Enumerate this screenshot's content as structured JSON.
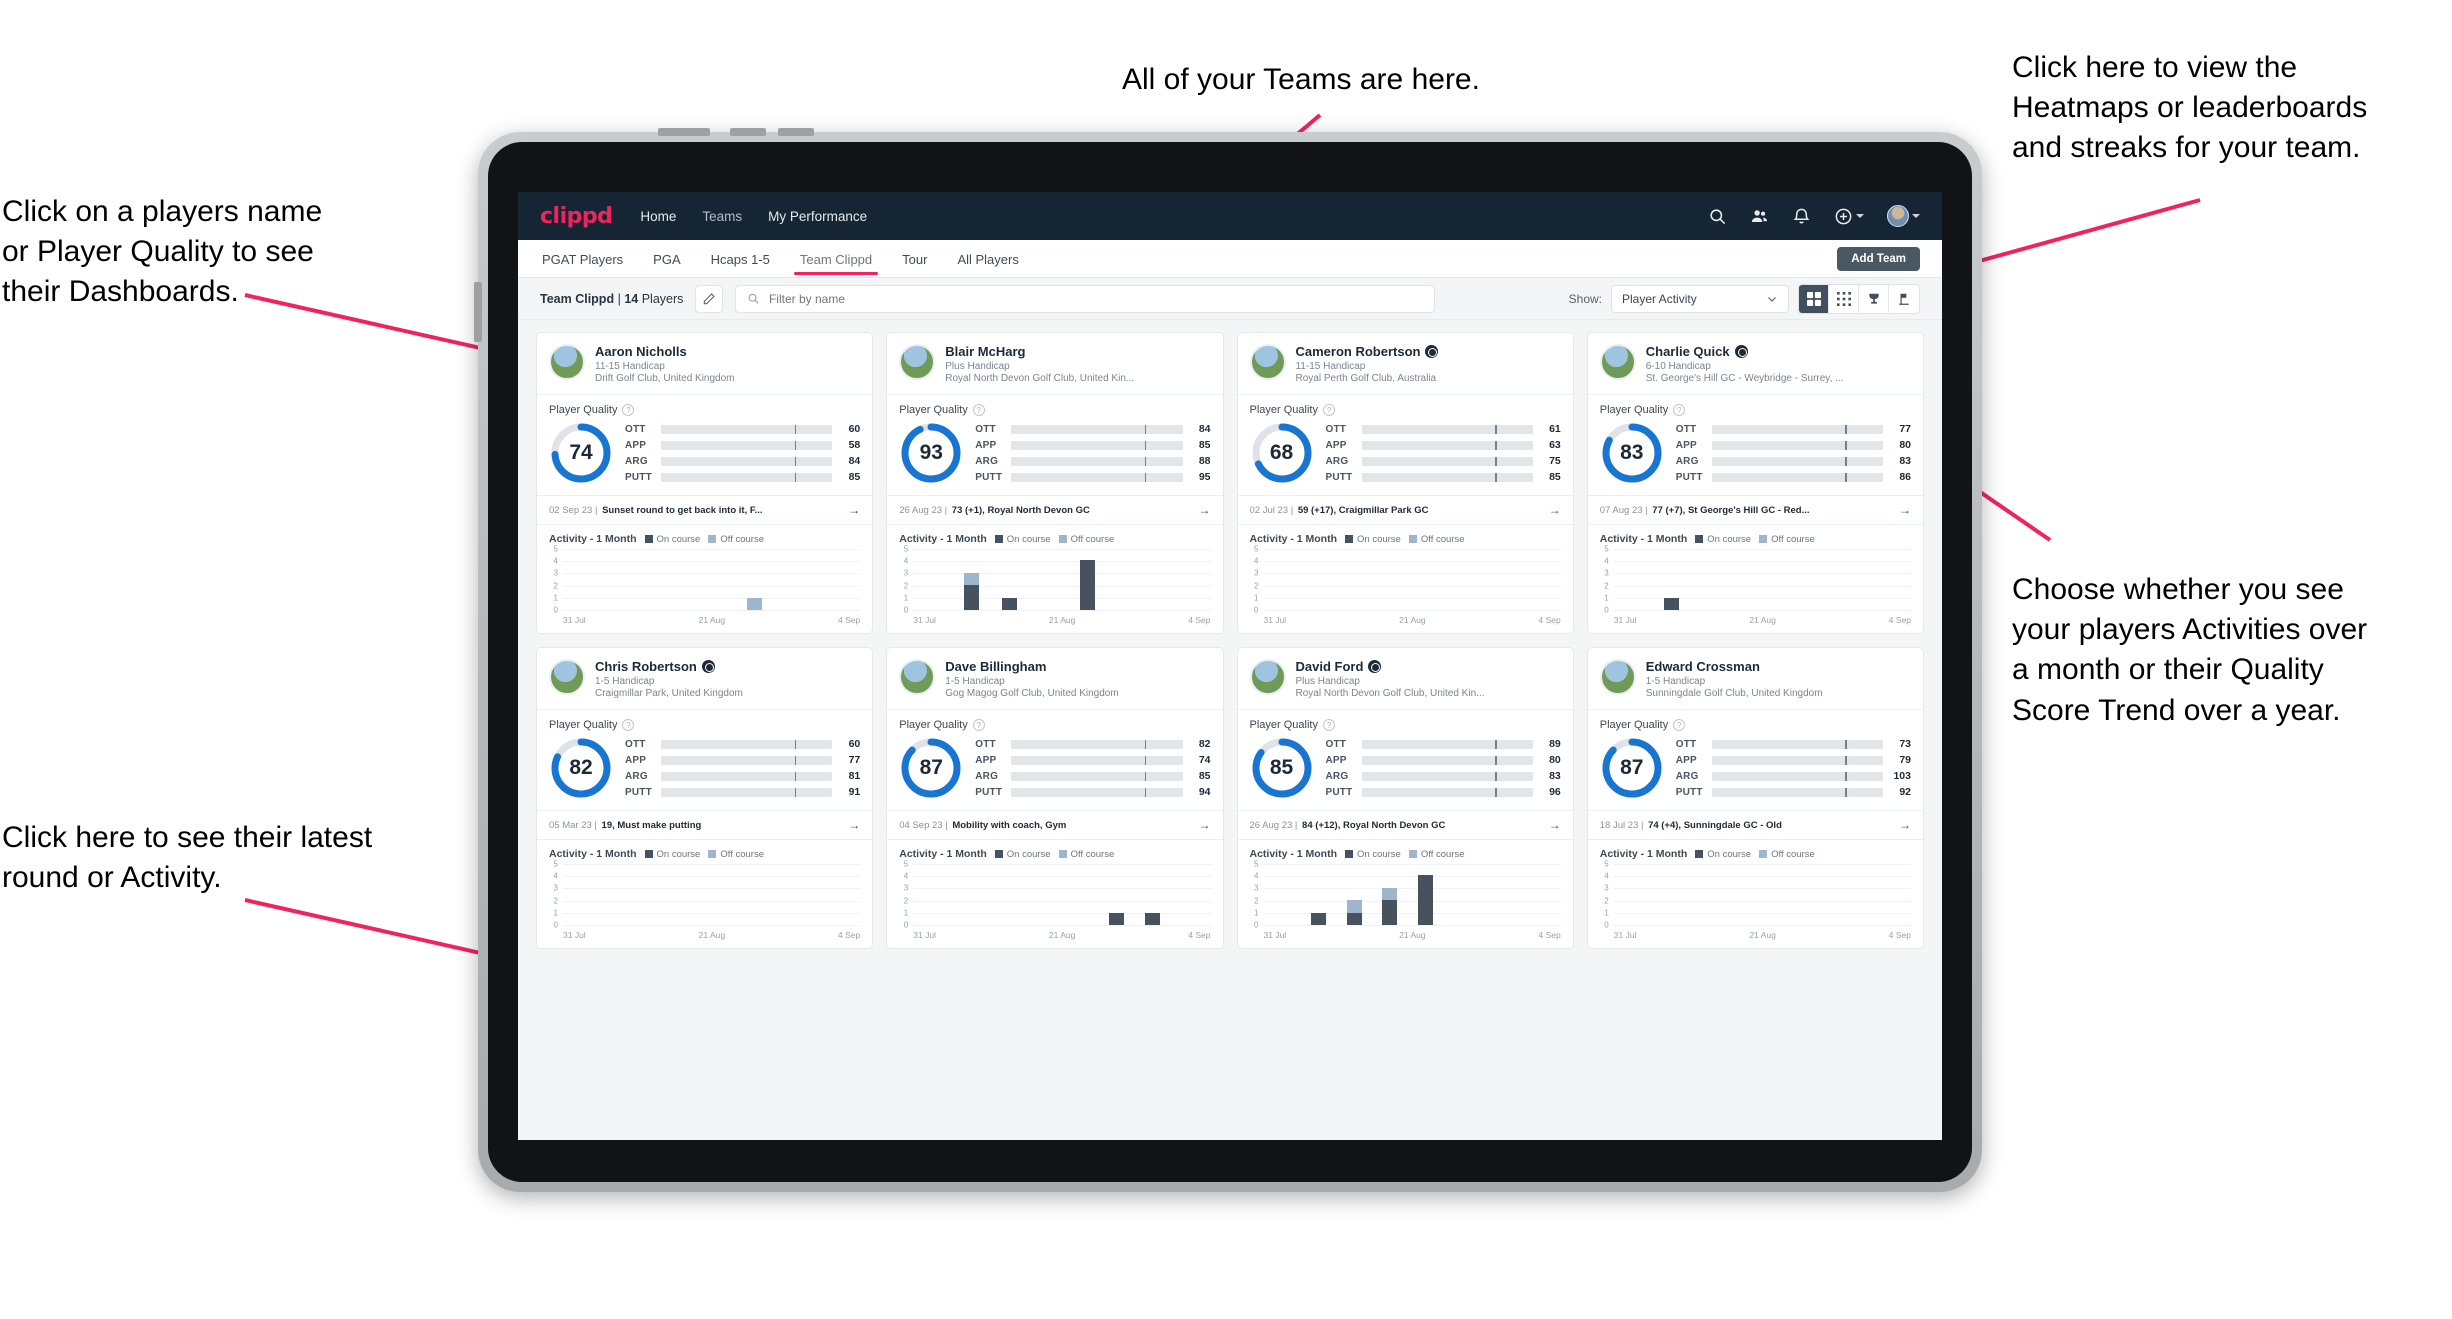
{
  "annotations": {
    "top": "All of your Teams are here.",
    "left_top": "Click on a players name\nor Player Quality to see\ntheir Dashboards.",
    "left_bottom": "Click here to see their latest\nround or Activity.",
    "right_top": "Click here to view the\nHeatmaps or leaderboards\nand streaks for your team.",
    "right_bottom": "Choose whether you see\nyour players Activities over\na month or their Quality\nScore Trend over a year."
  },
  "colors": {
    "brand_pink": "#f0245c",
    "nav_bg": "#152533",
    "ring_blue": "#1876d2",
    "ott": "#f5a623",
    "app": "#36d3ad",
    "arg": "#f5215e",
    "putt": "#a715d6",
    "on_course": "#46535f",
    "off_course": "#9db6cc"
  },
  "navbar": {
    "logo": "clippd",
    "links": [
      "Home",
      "Teams",
      "My Performance"
    ],
    "icons": [
      "search-icon",
      "people-icon",
      "bell-icon",
      "plus-circle-icon",
      "avatar"
    ]
  },
  "tabs": {
    "items": [
      "PGAT Players",
      "PGA",
      "Hcaps 1-5",
      "Team Clippd",
      "Tour",
      "All Players"
    ],
    "active": "Team Clippd",
    "add_team_label": "Add Team"
  },
  "filterbar": {
    "team_name": "Team Clippd",
    "separator": "|",
    "player_count": "14",
    "players_word": "Players",
    "search_placeholder": "Filter by name",
    "show_label": "Show:",
    "show_value": "Player Activity",
    "view_icons": [
      "grid-large-icon",
      "grid-dots-icon",
      "trophy-icon",
      "streaks-icon"
    ]
  },
  "card_common": {
    "player_quality_label": "Player Quality",
    "activity_label": "Activity - 1 Month",
    "legend_on": "On course",
    "legend_off": "Off course",
    "bar_labels": [
      "OTT",
      "APP",
      "ARG",
      "PUTT"
    ],
    "y_ticks": [
      "5",
      "4",
      "3",
      "2",
      "1",
      "0"
    ],
    "x_ticks": [
      "31 Jul",
      "21 Aug",
      "4 Sep"
    ]
  },
  "players": [
    {
      "name": "Aaron Nicholls",
      "verified": false,
      "handicap": "11-15 Handicap",
      "club": "Drift Golf Club, United Kingdom",
      "quality": 74,
      "metrics": [
        60,
        58,
        84,
        85
      ],
      "round_date": "02 Sep 23",
      "round_text": "Sunset round to get back into it, F...",
      "activity": [
        {
          "x": 62,
          "on": 0,
          "off": 1
        }
      ]
    },
    {
      "name": "Blair McHarg",
      "verified": false,
      "handicap": "Plus Handicap",
      "club": "Royal North Devon Golf Club, United Kin...",
      "quality": 93,
      "metrics": [
        84,
        85,
        88,
        95
      ],
      "round_date": "26 Aug 23",
      "round_text": "73 (+1), Royal North Devon GC",
      "activity": [
        {
          "x": 17,
          "on": 2,
          "off": 1
        },
        {
          "x": 30,
          "on": 1,
          "off": 0
        },
        {
          "x": 56,
          "on": 4,
          "off": 0
        }
      ]
    },
    {
      "name": "Cameron Robertson",
      "verified": true,
      "handicap": "11-15 Handicap",
      "club": "Royal Perth Golf Club, Australia",
      "quality": 68,
      "metrics": [
        61,
        63,
        75,
        85
      ],
      "round_date": "02 Jul 23",
      "round_text": "59 (+17), Craigmillar Park GC",
      "activity": []
    },
    {
      "name": "Charlie Quick",
      "verified": true,
      "handicap": "6-10 Handicap",
      "club": "St. George's Hill GC - Weybridge - Surrey, ...",
      "quality": 83,
      "metrics": [
        77,
        80,
        83,
        86
      ],
      "round_date": "07 Aug 23",
      "round_text": "77 (+7), St George's Hill GC - Red...",
      "activity": [
        {
          "x": 17,
          "on": 1,
          "off": 0
        }
      ]
    },
    {
      "name": "Chris Robertson",
      "verified": true,
      "handicap": "1-5 Handicap",
      "club": "Craigmillar Park, United Kingdom",
      "quality": 82,
      "metrics": [
        60,
        77,
        81,
        91
      ],
      "round_date": "05 Mar 23",
      "round_text": "19, Must make putting",
      "activity": []
    },
    {
      "name": "Dave Billingham",
      "verified": false,
      "handicap": "1-5 Handicap",
      "club": "Gog Magog Golf Club, United Kingdom",
      "quality": 87,
      "metrics": [
        82,
        74,
        85,
        94
      ],
      "round_date": "04 Sep 23",
      "round_text": "Mobility with coach, Gym",
      "activity": [
        {
          "x": 66,
          "on": 1,
          "off": 0
        },
        {
          "x": 78,
          "on": 1,
          "off": 0
        }
      ]
    },
    {
      "name": "David Ford",
      "verified": true,
      "handicap": "Plus Handicap",
      "club": "Royal North Devon Golf Club, United Kin...",
      "quality": 85,
      "metrics": [
        89,
        80,
        83,
        96
      ],
      "round_date": "26 Aug 23",
      "round_text": "84 (+12), Royal North Devon GC",
      "activity": [
        {
          "x": 16,
          "on": 1,
          "off": 0
        },
        {
          "x": 28,
          "on": 1,
          "off": 1
        },
        {
          "x": 40,
          "on": 2,
          "off": 1
        },
        {
          "x": 52,
          "on": 4,
          "off": 0
        }
      ]
    },
    {
      "name": "Edward Crossman",
      "verified": false,
      "handicap": "1-5 Handicap",
      "club": "Sunningdale Golf Club, United Kingdom",
      "quality": 87,
      "metrics": [
        73,
        79,
        103,
        92
      ],
      "round_date": "18 Jul 23",
      "round_text": "74 (+4), Sunningdale GC - Old",
      "activity": []
    }
  ]
}
